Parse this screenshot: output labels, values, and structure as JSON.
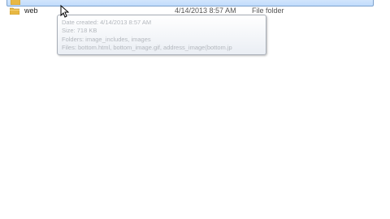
{
  "files": [
    {
      "name": "",
      "date": "",
      "type": "",
      "icon": "folder-icon",
      "selected": true
    },
    {
      "name": "web",
      "date": "4/14/2013 8:57 AM",
      "type": "File folder",
      "icon": "folder-icon",
      "selected": false
    }
  ],
  "tooltip": {
    "lines": [
      "Date created: 4/14/2013 8:57 AM",
      "Size: 718 KB",
      "Folders: image_includes, images",
      "Files: bottom.html, bottom_image.gif, address_image(bottom.jp"
    ]
  },
  "colors": {
    "selection_fill": "#c1dcfc",
    "selection_border": "#7da2ce",
    "folder_yellow": "#e8b843"
  }
}
